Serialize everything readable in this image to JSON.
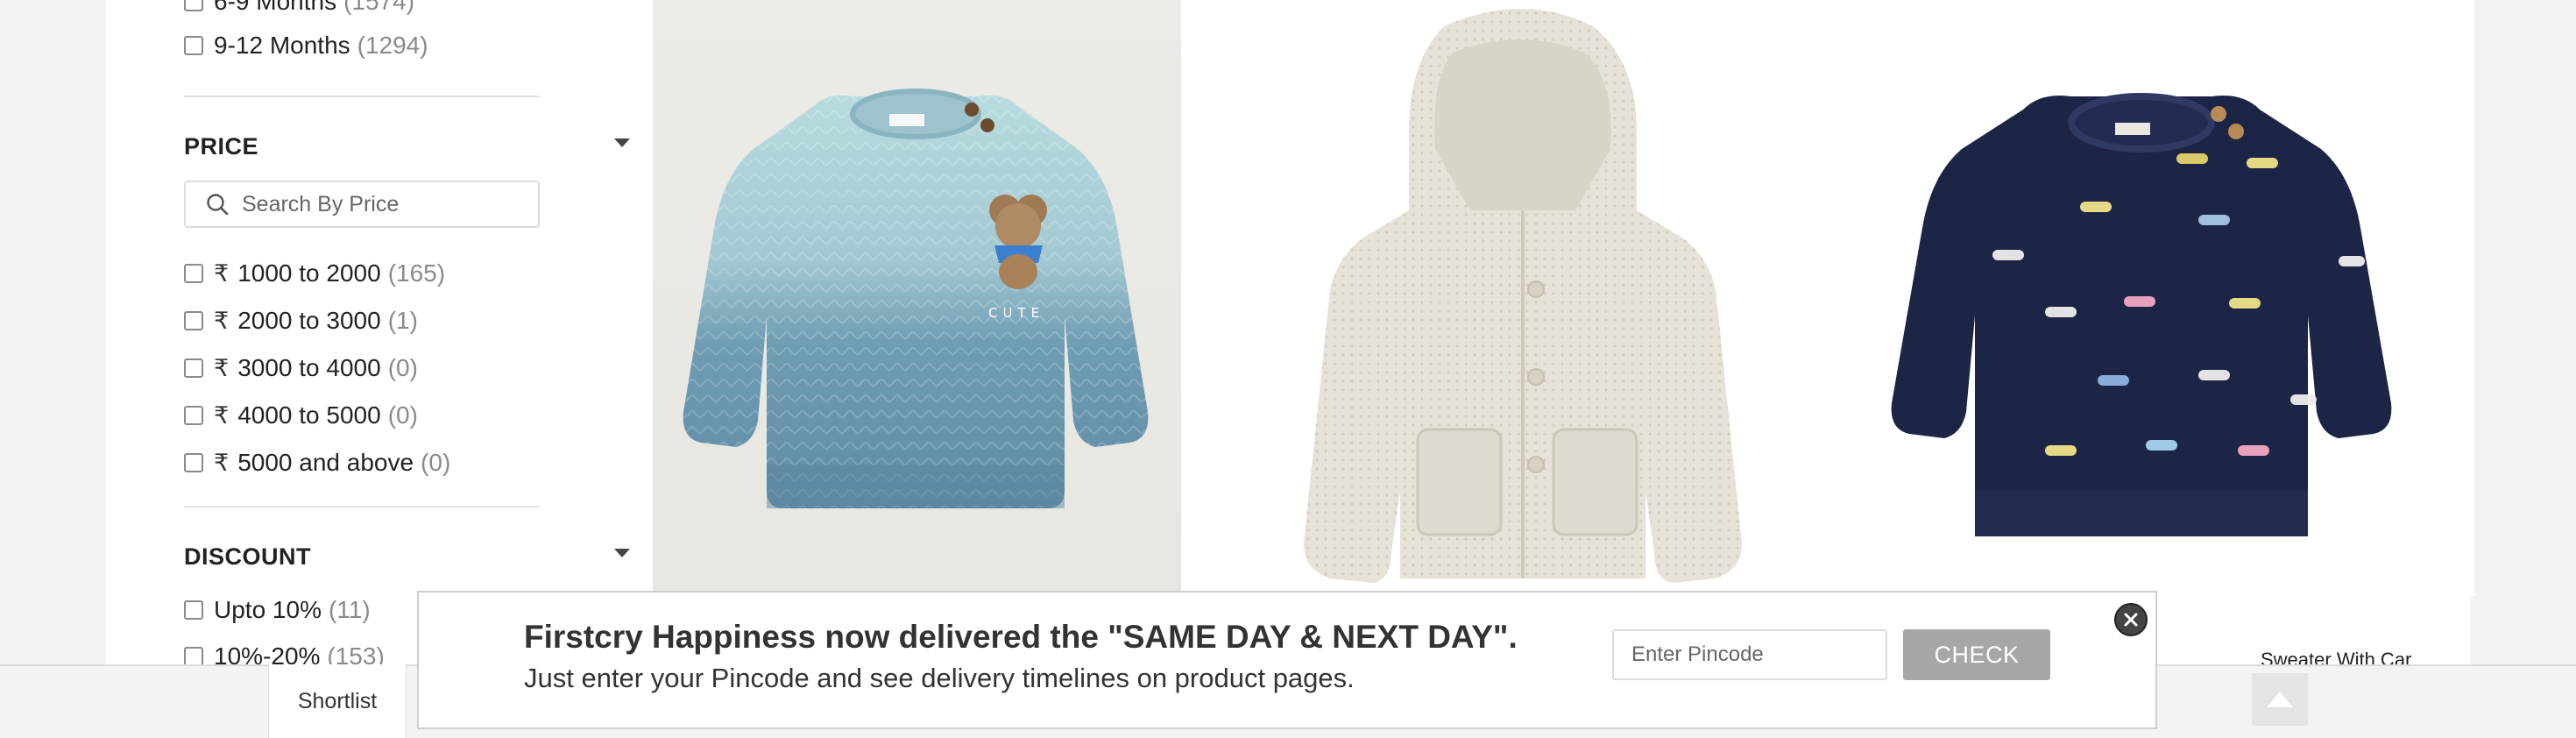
{
  "sidebar": {
    "age_partial": {
      "label": "6-9 Months",
      "count": "(1574)"
    },
    "age_option": {
      "label": "9-12 Months",
      "count": "(1294)"
    },
    "price": {
      "title": "PRICE",
      "search_placeholder": "Search By Price",
      "currency_symbol": "₹",
      "options": [
        {
          "label": "1000 to 2000",
          "count": "(165)"
        },
        {
          "label": "2000 to 3000",
          "count": "(1)"
        },
        {
          "label": "3000 to 4000",
          "count": "(0)"
        },
        {
          "label": "4000 to 5000",
          "count": "(0)"
        },
        {
          "label": "5000 and above",
          "count": "(0)"
        }
      ]
    },
    "discount": {
      "title": "DISCOUNT",
      "options": [
        {
          "label": "Upto 10%",
          "count": "(11)"
        },
        {
          "label": "10%-20%",
          "count": "(153)"
        }
      ]
    }
  },
  "products": [
    {
      "icon": "blue-ombre-bear-sweater-image",
      "print": "CUTE"
    },
    {
      "icon": "cream-hooded-cardigan-image"
    },
    {
      "icon": "navy-car-sweater-image",
      "name_partial": "Sweater With Car"
    }
  ],
  "bottom_bar": {
    "shortlist_label": "Shortlist"
  },
  "banner": {
    "line1": "Firstcry Happiness now delivered the \"SAME DAY & NEXT DAY\".",
    "line2": "Just enter your Pincode and see delivery timelines on product pages.",
    "pincode_placeholder": "Enter Pincode",
    "check_label": "CHECK"
  },
  "colors": {
    "check_button": "#a7a7a7",
    "divider": "#e2e2e2",
    "count_text": "#8a8a8a"
  }
}
